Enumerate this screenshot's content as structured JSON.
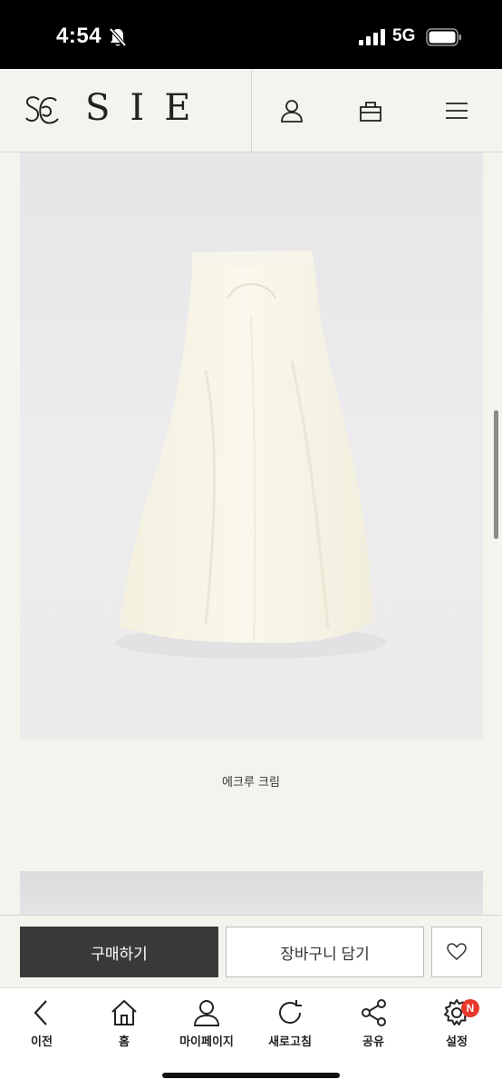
{
  "status_bar": {
    "time": "4:54",
    "network": "5G",
    "icons": [
      "bell-off-icon",
      "signal-icon",
      "battery-icon"
    ]
  },
  "header": {
    "logo_text": "SIE",
    "icons": [
      "user-icon",
      "shopping-bag-icon",
      "menu-icon"
    ]
  },
  "product": {
    "color_caption": "에크루 크림"
  },
  "purchase_bar": {
    "buy_label": "구매하기",
    "cart_label": "장바구니 담기",
    "wishlist_icon": "heart-icon"
  },
  "bottom_nav": {
    "items": [
      {
        "label": "이전",
        "icon": "back-icon"
      },
      {
        "label": "홈",
        "icon": "home-icon"
      },
      {
        "label": "마이페이지",
        "icon": "user-icon"
      },
      {
        "label": "새로고침",
        "icon": "refresh-icon"
      },
      {
        "label": "공유",
        "icon": "share-icon"
      },
      {
        "label": "설정",
        "icon": "settings-icon",
        "badge": "N"
      }
    ]
  },
  "colors": {
    "background": "#f4f3ee",
    "buy_button": "#3a3a3a",
    "badge": "#e8382c"
  }
}
